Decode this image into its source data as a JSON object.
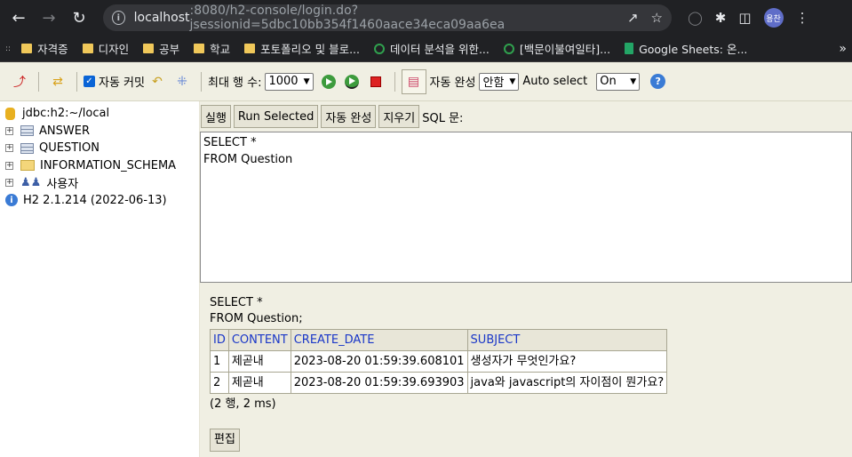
{
  "browser": {
    "url_host": "localhost",
    "url_rest": ":8080/h2-console/login.do?jsessionid=5dbc10bb354f1460aace34eca09aa6ea",
    "avatar_text": "용찬",
    "bookmarks": [
      "자격증",
      "디자인",
      "공부",
      "학교",
      "포토폴리오 및 블로...",
      "데이터 분석을 위한...",
      "[백문이불여일타]...",
      "Google Sheets: 온..."
    ]
  },
  "toolbar": {
    "autocommit_label": "자동 커밋",
    "maxrows_label": "최대 행 수:",
    "maxrows_value": "1000",
    "autocomplete_label": "자동 완성",
    "autocomplete_value": "안함",
    "autoselect_label": "Auto select",
    "autoselect_value": "On"
  },
  "tree": {
    "connection": "jdbc:h2:~/local",
    "items": [
      "ANSWER",
      "QUESTION",
      "INFORMATION_SCHEMA",
      "사용자"
    ],
    "version": "H2 2.1.214 (2022-06-13)"
  },
  "query": {
    "run_label": "실행",
    "run_selected_label": "Run Selected",
    "autocomplete_label": "자동 완성",
    "clear_label": "지우기",
    "sql_label": "SQL 문:",
    "sql_text": "SELECT *\nFROM Question"
  },
  "result": {
    "echo_line1": "SELECT *",
    "echo_line2": "FROM Question;",
    "columns": [
      "ID",
      "CONTENT",
      "CREATE_DATE",
      "SUBJECT"
    ],
    "rows": [
      [
        "1",
        "제곧내",
        "2023-08-20 01:59:39.608101",
        "생성자가 무엇인가요?"
      ],
      [
        "2",
        "제곧내",
        "2023-08-20 01:59:39.693903",
        "java와 javascript의 자이점이 뭔가요?"
      ]
    ],
    "summary": "(2 행, 2 ms)",
    "edit_label": "편집"
  }
}
